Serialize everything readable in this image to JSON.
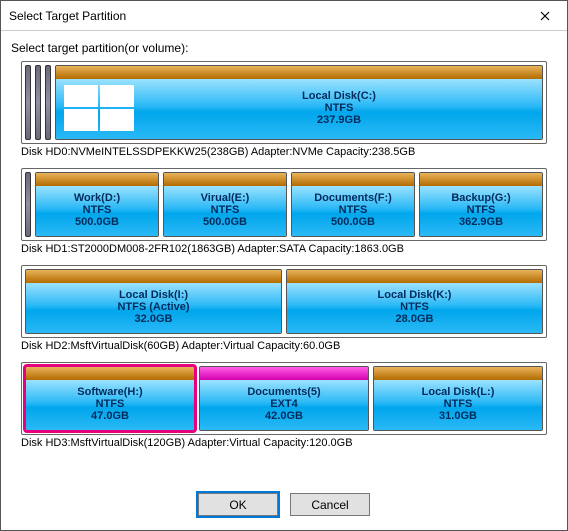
{
  "window": {
    "title": "Select Target Partition"
  },
  "subtitle": "Select target partition(or volume):",
  "disks": [
    {
      "caption": "Disk HD0:NVMeINTELSSDPEKKW25(238GB)  Adapter:NVMe  Capacity:238.5GB",
      "leading_unalloc": 3,
      "parts": [
        {
          "label": "Local Disk(C:)",
          "fs": "NTFS",
          "size": "237.9GB",
          "header": "ntfs",
          "system": true
        }
      ]
    },
    {
      "caption": "Disk HD1:ST2000DM008-2FR102(1863GB)  Adapter:SATA  Capacity:1863.0GB",
      "leading_unalloc": 1,
      "parts": [
        {
          "label": "Work(D:)",
          "fs": "NTFS",
          "size": "500.0GB",
          "header": "ntfs"
        },
        {
          "label": "Virual(E:)",
          "fs": "NTFS",
          "size": "500.0GB",
          "header": "ntfs"
        },
        {
          "label": "Documents(F:)",
          "fs": "NTFS",
          "size": "500.0GB",
          "header": "ntfs"
        },
        {
          "label": "Backup(G:)",
          "fs": "NTFS",
          "size": "362.9GB",
          "header": "ntfs"
        }
      ]
    },
    {
      "caption": "Disk HD2:MsftVirtualDisk(60GB)  Adapter:Virtual  Capacity:60.0GB",
      "leading_unalloc": 0,
      "parts": [
        {
          "label": "Local Disk(I:)",
          "fs": "NTFS (Active)",
          "size": "32.0GB",
          "header": "ntfs"
        },
        {
          "label": "Local Disk(K:)",
          "fs": "NTFS",
          "size": "28.0GB",
          "header": "ntfs"
        }
      ]
    },
    {
      "caption": "Disk HD3:MsftVirtualDisk(120GB)  Adapter:Virtual  Capacity:120.0GB",
      "leading_unalloc": 0,
      "parts": [
        {
          "label": "Software(H:)",
          "fs": "NTFS",
          "size": "47.0GB",
          "header": "ntfs",
          "selected": true
        },
        {
          "label": "Documents(5)",
          "fs": "EXT4",
          "size": "42.0GB",
          "header": "ext"
        },
        {
          "label": "Local Disk(L:)",
          "fs": "NTFS",
          "size": "31.0GB",
          "header": "ntfs"
        }
      ]
    }
  ],
  "buttons": {
    "ok": "OK",
    "cancel": "Cancel"
  }
}
